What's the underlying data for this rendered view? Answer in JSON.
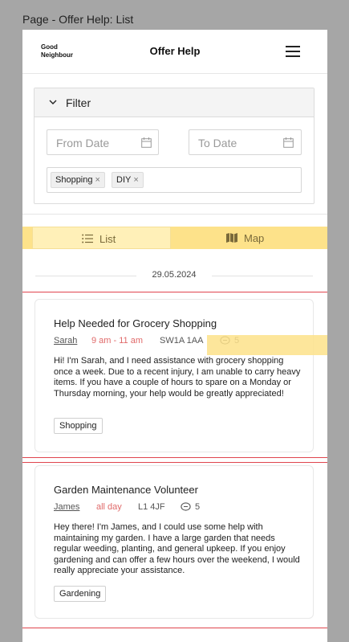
{
  "page_label": "Page - Offer Help: List",
  "header": {
    "logo_line1": "Good",
    "logo_line2": "Neighbour",
    "title": "Offer Help",
    "menu_icon": "hamburger-menu-icon"
  },
  "filter": {
    "title": "Filter",
    "toggle_icon": "chevron-down-icon",
    "from_date_placeholder": "From Date",
    "to_date_placeholder": "To Date",
    "date_icon": "calendar-icon",
    "tags": [
      {
        "label": "Shopping",
        "remove": "×"
      },
      {
        "label": "DIY",
        "remove": "×"
      }
    ]
  },
  "tabs": [
    {
      "label": "List",
      "icon": "list-icon",
      "selected": true
    },
    {
      "label": "Map",
      "icon": "map-icon",
      "selected": false
    }
  ],
  "date_divider": "29.05.2024",
  "posts": [
    {
      "title": "Help Needed for Grocery Shopping",
      "author": "Sarah",
      "time": "9 am - 11 am",
      "postcode": "SW1A 1AA",
      "comments": "5",
      "description": "Hi! I'm Sarah, and I need assistance with grocery shopping once a week. Due to a recent injury, I am unable to carry heavy items. If you have a couple of hours to spare on a Monday or Thursday morning, your help would be greatly appreciated!",
      "tag": "Shopping"
    },
    {
      "title": "Garden Maintenance Volunteer",
      "author": "James",
      "time": "all day",
      "postcode": "L1 4JF",
      "comments": "5",
      "description": "Hey there! I'm James, and I could use some help with maintaining my garden. I have a large garden that needs regular weeding, planting, and general upkeep. If you enjoy gardening and can offer a few hours over the weekend, I would really appreciate your assistance.",
      "tag": "Gardening"
    }
  ],
  "colors": {
    "highlight": "#fde28a",
    "frame_red": "#e0454e",
    "time_red": "#e06a6a",
    "backdrop": "#a6a6a6"
  }
}
